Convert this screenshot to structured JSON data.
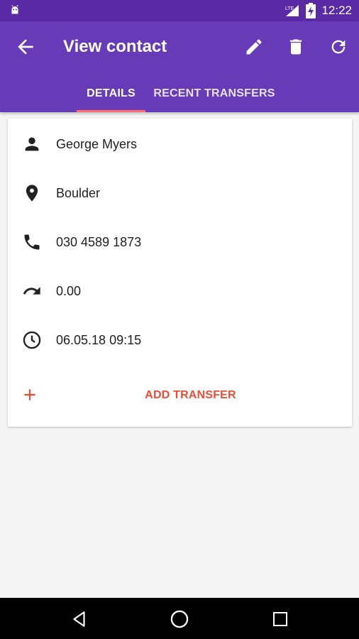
{
  "status_bar": {
    "time": "12:22",
    "icons": [
      "android-notification-icon",
      "lte-signal-icon",
      "battery-charging-icon"
    ]
  },
  "app_bar": {
    "title": "View contact",
    "back_icon": "arrow-back-icon",
    "actions": [
      "edit-icon",
      "delete-icon",
      "refresh-icon"
    ]
  },
  "tabs": [
    {
      "label": "DETAILS",
      "active": true
    },
    {
      "label": "RECENT TRANSFERS",
      "active": false
    }
  ],
  "details": {
    "name": {
      "icon": "person-icon",
      "value": "George Myers"
    },
    "location": {
      "icon": "location-pin-icon",
      "value": "Boulder"
    },
    "phone": {
      "icon": "phone-icon",
      "value": "030 4589 1873"
    },
    "balance": {
      "icon": "redo-arrow-icon",
      "value": "0.00"
    },
    "datetime": {
      "icon": "clock-icon",
      "value": "06.05.18 09:15"
    }
  },
  "add_transfer": {
    "label": "ADD TRANSFER",
    "icon": "plus-icon"
  },
  "colors": {
    "primary": "#673ab7",
    "status_bar": "#5a2aa6",
    "accent": "#ef4b32",
    "tab_indicator": "#ff6e6e"
  },
  "nav_bar": [
    "back-triangle-icon",
    "home-circle-icon",
    "recents-square-icon"
  ]
}
